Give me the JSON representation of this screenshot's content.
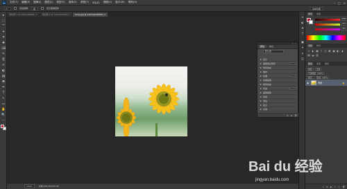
{
  "app": {
    "logo": "Ps",
    "menu": [
      "文件(F)",
      "编辑(E)",
      "图像(I)",
      "图层(L)",
      "类型(Y)",
      "选择(S)",
      "滤镜(T)",
      "3D(D)",
      "视图(V)",
      "窗口(W)",
      "帮助(H)"
    ],
    "window_controls": [
      "–",
      "□",
      "×"
    ]
  },
  "options_bar": {
    "tool_preset": "▾",
    "auto_select_label": "自动选择:",
    "auto_select_value": "组",
    "show_transform": "显示变换控件",
    "workspace": "基本功能"
  },
  "doc_tabs": [
    {
      "label": "未标题-1 @ 100%(RGB/8) ×",
      "active": false
    },
    {
      "label": "未标题-2 @ 100%(RGB/8) ×",
      "active": false
    },
    {
      "label": "timg.jpg @ 100%(RGB/8#) ×",
      "active": true
    }
  ],
  "tools": [
    "▸",
    "⬚",
    "⌒",
    "✦",
    "⌗",
    "✚",
    "⌫",
    "✎",
    "⎘",
    "✍",
    "◐",
    "▤",
    "◓",
    "✒",
    "T",
    "↖",
    "▭",
    "✋",
    "🔍",
    "⋯"
  ],
  "canvas": {
    "image_colors": {
      "petal": "#f5b81c",
      "center": "#7a8a1e",
      "bg": "#eeeeec"
    }
  },
  "status": {
    "zoom": "100%",
    "doc": "文档:293.0K/293.0K"
  },
  "properties_panel": {
    "tabs": [
      "属性",
      "信息"
    ],
    "combo": "默认值",
    "rows": [
      "显示",
      "画笔笔尖形状",
      "形状动态",
      "散布",
      "纹理",
      "双重画笔",
      "颜色动态",
      "传递",
      "画笔笔势",
      "杂色",
      "湿边",
      "建立",
      "平滑",
      "保护纹理",
      "方位"
    ],
    "button": "确定",
    "bottom_icons": [
      "⚙",
      "⊞",
      "🗑"
    ]
  },
  "dock": [
    "≡",
    "◐",
    "⚙",
    "T",
    "▣",
    "✦",
    "⌂",
    "◫"
  ],
  "right": {
    "color_tabs": [
      "颜色",
      "色板"
    ],
    "rgb": [
      {
        "label": "R",
        "value": "196"
      },
      {
        "label": "G",
        "value": "16"
      },
      {
        "label": "B",
        "value": "46"
      }
    ],
    "sub_tabs": [
      "调整",
      "样式"
    ],
    "adjust_label": "添加调整",
    "adj_icons": [
      "☼",
      "◐",
      "▦",
      "▽",
      "◫",
      "◩",
      "▣",
      "◧",
      "◑",
      "▤",
      "◒",
      "▥"
    ],
    "layers_tabs": [
      "图层",
      "通道",
      "路径"
    ],
    "kind": "类型",
    "blend": "正常",
    "opacity": "不透明度: 100%",
    "lock": "锁定:",
    "fill": "填充: 100%",
    "layer_name": "背景",
    "layers_bottom_icons": [
      "∞",
      "fx",
      "◐",
      "▭",
      "□",
      "🗑"
    ]
  },
  "watermark": {
    "brand": "Bai du 经验",
    "url": "jingyan.baidu.com"
  }
}
